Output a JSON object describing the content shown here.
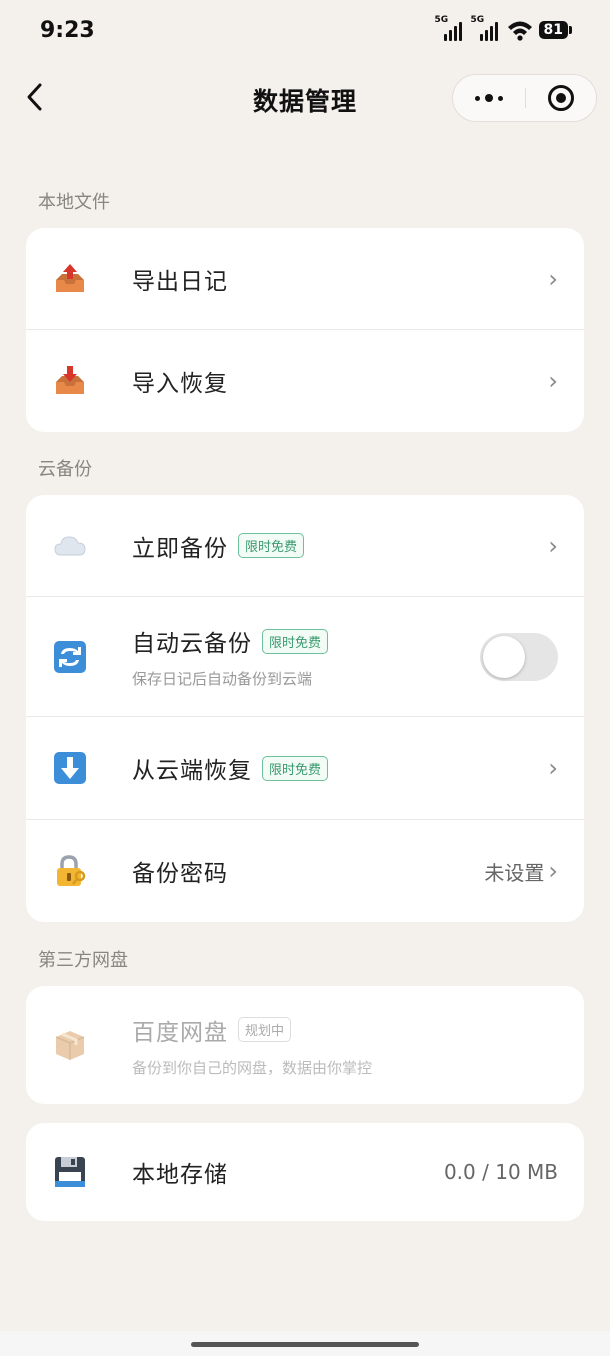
{
  "status": {
    "time": "9:23",
    "sig1": "5G",
    "sig2": "5G",
    "battery": "81"
  },
  "nav": {
    "title": "数据管理"
  },
  "sections": {
    "local": "本地文件",
    "cloud": "云备份",
    "third": "第三方网盘"
  },
  "local": {
    "export": "导出日记",
    "import": "导入恢复"
  },
  "cloud": {
    "backup_now": "立即备份",
    "backup_now_tag": "限时免费",
    "auto": "自动云备份",
    "auto_tag": "限时免费",
    "auto_sub": "保存日记后自动备份到云端",
    "auto_enabled": false,
    "restore": "从云端恢复",
    "restore_tag": "限时免费",
    "password": "备份密码",
    "password_value": "未设置"
  },
  "third": {
    "baidu": "百度网盘",
    "baidu_tag": "规划中",
    "baidu_sub": "备份到你自己的网盘，数据由你掌控"
  },
  "storage": {
    "label": "本地存储",
    "value": "0.0 / 10 MB"
  }
}
